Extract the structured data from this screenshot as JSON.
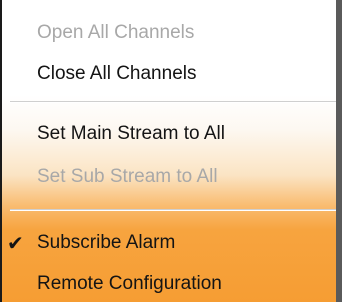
{
  "context_menu": {
    "items": [
      {
        "label": "Open All Channels",
        "enabled": false,
        "checked": false
      },
      {
        "label": "Close All Channels",
        "enabled": true,
        "checked": false
      },
      {
        "label": "Set Main Stream to All",
        "enabled": true,
        "checked": false
      },
      {
        "label": "Set Sub Stream to All",
        "enabled": false,
        "checked": false
      },
      {
        "label": "Subscribe Alarm",
        "enabled": true,
        "checked": true,
        "check_glyph": "✔"
      },
      {
        "label": "Remote Configuration",
        "enabled": true,
        "checked": false
      }
    ]
  },
  "colors": {
    "highlight_orange": "#f69d33",
    "disabled_text": "#a8a8a8",
    "enabled_text": "#141414"
  }
}
